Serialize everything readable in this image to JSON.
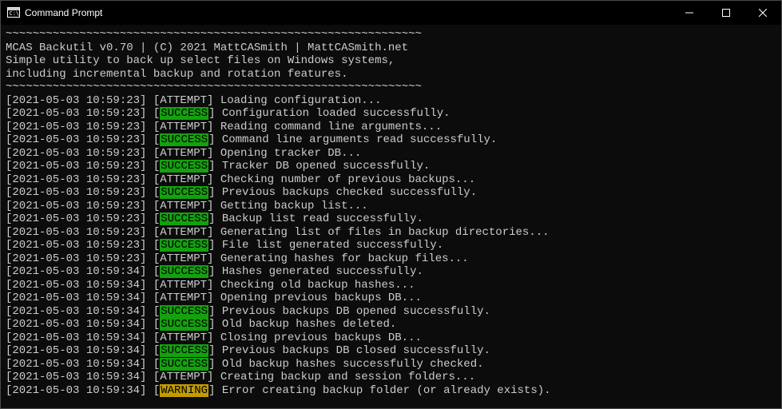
{
  "window": {
    "title": "Command Prompt"
  },
  "header": {
    "tilde_width": 62,
    "line1": "MCAS Backutil v0.70 | (C) 2021 MattCASmith | MattCASmith.net",
    "desc1": "Simple utility to back up select files on Windows systems,",
    "desc2": "including incremental backup and rotation features."
  },
  "log": [
    {
      "ts": "2021-05-03 10:59:23",
      "tag": "ATTEMPT",
      "msg": "Loading configuration..."
    },
    {
      "ts": "2021-05-03 10:59:23",
      "tag": "SUCCESS",
      "msg": "Configuration loaded successfully."
    },
    {
      "ts": "2021-05-03 10:59:23",
      "tag": "ATTEMPT",
      "msg": "Reading command line arguments..."
    },
    {
      "ts": "2021-05-03 10:59:23",
      "tag": "SUCCESS",
      "msg": "Command line arguments read successfully."
    },
    {
      "ts": "2021-05-03 10:59:23",
      "tag": "ATTEMPT",
      "msg": "Opening tracker DB..."
    },
    {
      "ts": "2021-05-03 10:59:23",
      "tag": "SUCCESS",
      "msg": "Tracker DB opened successfully."
    },
    {
      "ts": "2021-05-03 10:59:23",
      "tag": "ATTEMPT",
      "msg": "Checking number of previous backups..."
    },
    {
      "ts": "2021-05-03 10:59:23",
      "tag": "SUCCESS",
      "msg": "Previous backups checked successfully."
    },
    {
      "ts": "2021-05-03 10:59:23",
      "tag": "ATTEMPT",
      "msg": "Getting backup list..."
    },
    {
      "ts": "2021-05-03 10:59:23",
      "tag": "SUCCESS",
      "msg": "Backup list read successfully."
    },
    {
      "ts": "2021-05-03 10:59:23",
      "tag": "ATTEMPT",
      "msg": "Generating list of files in backup directories..."
    },
    {
      "ts": "2021-05-03 10:59:23",
      "tag": "SUCCESS",
      "msg": "File list generated successfully."
    },
    {
      "ts": "2021-05-03 10:59:23",
      "tag": "ATTEMPT",
      "msg": "Generating hashes for backup files..."
    },
    {
      "ts": "2021-05-03 10:59:34",
      "tag": "SUCCESS",
      "msg": "Hashes generated successfully."
    },
    {
      "ts": "2021-05-03 10:59:34",
      "tag": "ATTEMPT",
      "msg": "Checking old backup hashes..."
    },
    {
      "ts": "2021-05-03 10:59:34",
      "tag": "ATTEMPT",
      "msg": "Opening previous backups DB..."
    },
    {
      "ts": "2021-05-03 10:59:34",
      "tag": "SUCCESS",
      "msg": "Previous backups DB opened successfully."
    },
    {
      "ts": "2021-05-03 10:59:34",
      "tag": "SUCCESS",
      "msg": "Old backup hashes deleted."
    },
    {
      "ts": "2021-05-03 10:59:34",
      "tag": "ATTEMPT",
      "msg": "Closing previous backups DB..."
    },
    {
      "ts": "2021-05-03 10:59:34",
      "tag": "SUCCESS",
      "msg": "Previous backups DB closed successfully."
    },
    {
      "ts": "2021-05-03 10:59:34",
      "tag": "SUCCESS",
      "msg": "Old backup hashes successfully checked."
    },
    {
      "ts": "2021-05-03 10:59:34",
      "tag": "ATTEMPT",
      "msg": "Creating backup and session folders..."
    },
    {
      "ts": "2021-05-03 10:59:34",
      "tag": "WARNING",
      "msg": "Error creating backup folder (or already exists)."
    }
  ]
}
